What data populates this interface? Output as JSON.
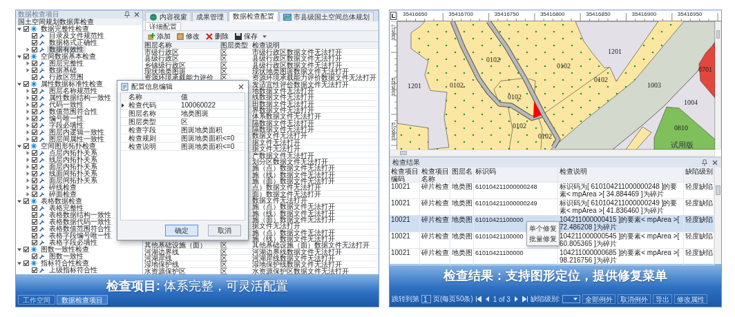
{
  "config_screen": {
    "tree": {
      "title": "数据检查项目",
      "root": "国土空间规划数据库检查",
      "groups": [
        {
          "label": "数据完整性检查",
          "checked": true,
          "expanded": true,
          "selected": false,
          "children": [
            {
              "label": "目录及文件规范性",
              "checked": true,
              "collapsed": false,
              "selected": false
            },
            {
              "label": "数据格式正确性",
              "checked": true,
              "collapsed": false,
              "selected": false
            },
            {
              "label": "数据有效性",
              "checked": true,
              "collapsed": true,
              "selected": true
            }
          ]
        },
        {
          "label": "空间数据基本检查",
          "checked": true,
          "expanded": true,
          "selected": false,
          "children": [
            {
              "label": "图层完整性",
              "checked": true,
              "collapsed": true,
              "selected": false
            },
            {
              "label": "数据基础",
              "checked": true,
              "collapsed": true,
              "selected": false
            },
            {
              "label": "行政区范围",
              "checked": true,
              "collapsed": false,
              "selected": false
            }
          ]
        },
        {
          "label": "属性数据标准性检查",
          "checked": true,
          "expanded": true,
          "selected": false,
          "children": [
            {
              "label": "图层名称规范性",
              "checked": true,
              "collapsed": true,
              "selected": false
            },
            {
              "label": "属性数据结构一致性",
              "checked": true,
              "collapsed": true,
              "selected": false
            },
            {
              "label": "代码一致性",
              "checked": true,
              "collapsed": true,
              "selected": false
            },
            {
              "label": "数值范围符合性",
              "checked": true,
              "collapsed": true,
              "selected": false
            },
            {
              "label": "编号唯一性",
              "checked": true,
              "collapsed": true,
              "selected": false
            },
            {
              "label": "字段必填性",
              "checked": true,
              "collapsed": true,
              "selected": false
            },
            {
              "label": "图层内逻辑一致性",
              "checked": true,
              "collapsed": true,
              "selected": false
            },
            {
              "label": "图层间属性一致性",
              "checked": true,
              "collapsed": true,
              "selected": false
            }
          ]
        },
        {
          "label": "空间图形拓扑检查",
          "checked": true,
          "expanded": true,
          "selected": false,
          "children": [
            {
              "label": "点层内拓扑关系",
              "checked": true,
              "collapsed": true,
              "selected": false
            },
            {
              "label": "线层内拓扑关系",
              "checked": true,
              "collapsed": true,
              "selected": false
            },
            {
              "label": "面层内拓扑关系",
              "checked": true,
              "collapsed": true,
              "selected": false
            },
            {
              "label": "线面间拓扑关系",
              "checked": true,
              "collapsed": true,
              "selected": false
            },
            {
              "label": "面层间拓扑关系",
              "checked": true,
              "collapsed": true,
              "selected": false
            },
            {
              "label": "碎线检查",
              "checked": true,
              "collapsed": true,
              "selected": false
            },
            {
              "label": "碎面检查",
              "checked": true,
              "collapsed": true,
              "selected": false
            }
          ]
        },
        {
          "label": "表格数据检查",
          "checked": true,
          "expanded": true,
          "selected": false,
          "children": [
            {
              "label": "表格完整性",
              "checked": true,
              "collapsed": false,
              "selected": false
            },
            {
              "label": "表格数据结构一致性",
              "checked": true,
              "collapsed": false,
              "selected": false
            },
            {
              "label": "表格数据代码一致性",
              "checked": true,
              "collapsed": false,
              "selected": false
            },
            {
              "label": "表格数值范围符合性",
              "checked": true,
              "collapsed": false,
              "selected": false
            },
            {
              "label": "表格字段编号唯一性",
              "checked": true,
              "collapsed": false,
              "selected": false
            },
            {
              "label": "表格字段必填性",
              "checked": true,
              "collapsed": false,
              "selected": false
            }
          ]
        },
        {
          "label": "图数一致性检查",
          "checked": true,
          "expanded": true,
          "selected": false,
          "children": [
            {
              "label": "图数一致性",
              "checked": true,
              "collapsed": false,
              "selected": false
            }
          ]
        },
        {
          "label": "指标符合性检查",
          "checked": true,
          "expanded": true,
          "selected": false,
          "children": [
            {
              "label": "上级指标符合性",
              "checked": true,
              "collapsed": false,
              "selected": false
            }
          ]
        }
      ]
    },
    "tabs": [
      {
        "label": "内容视窗",
        "kind": "icon",
        "selected": false
      },
      {
        "label": "成果管理",
        "kind": "plain",
        "selected": false
      },
      {
        "label": "数据检查配置",
        "kind": "plain",
        "selected": true
      },
      {
        "label": "市县级国土空间总体规划",
        "kind": "icon",
        "selected": false
      }
    ],
    "subtab": "详细配置",
    "toolbar": [
      "添加",
      "修改",
      "删除",
      "保存"
    ],
    "table": {
      "columns": [
        "图层名称",
        "图层类型",
        "检查说明"
      ],
      "rows": [
        {
          "name": "市级行政区",
          "type": "区",
          "note": "市级行政区数据文件无法打开"
        },
        {
          "name": "县级行政区",
          "type": "区",
          "note": "县级行政区数据文件无法打开"
        },
        {
          "name": "乡镇级行政区",
          "type": "区",
          "note": "县级行政区数据文件无法打开"
        },
        {
          "name": "现状地类图斑",
          "type": "区",
          "note": "现状地类图斑数据文件无法打开"
        },
        {
          "name": "资源环境承载能力评价",
          "type": "区",
          "note": "资源环境承载能力评价数据文件无法打开"
        },
        {
          "note": "发适宜性评价数据文件无法打开"
        },
        {
          "note": "地数据文件无法打开"
        },
        {
          "note": "线数据文件无法打开"
        },
        {
          "note": "田数据文件无法打开"
        },
        {
          "note": "界数据文件无法打开"
        },
        {
          "note": "体系数据文件无法打开"
        },
        {
          "note": "隔数据文件无法打开"
        },
        {
          "note": "隔数据文件无法打开"
        },
        {
          "note": "数据文件无法打开"
        },
        {
          "note": "据文件无法打开"
        },
        {
          "note": "据文件无法打开"
        },
        {
          "note": "产数据文件无法打开"
        },
        {
          "note": "划分区数据文件无法打开"
        },
        {
          "note": "施（点）数据文件无法打开"
        },
        {
          "note": "施（线）数据文件无法打开"
        },
        {
          "note": "施（面）数据文件无法打开"
        },
        {
          "note": "点）数据文件无法打开"
        },
        {
          "note": "面）数据文件无法打开"
        },
        {
          "note": "数据文件无法打开"
        },
        {
          "note": "施（点）数据文件无法打开"
        },
        {
          "note": "施（线）数据文件无法打开"
        },
        {
          "note": "施（面）数据文件无法打开"
        },
        {
          "note": "据文件无法打开"
        },
        {
          "note": "施（点）数据文件无法打开"
        },
        {
          "note": "施（线）数据文件无法打开"
        },
        {
          "name": "其他基础设施（面）",
          "type": "区",
          "note": "其他基础设施（面）数据文件无法打开"
        },
        {
          "name": "河湖边界线",
          "type": "区",
          "note": "河湖边界线数据文件无法打开"
        },
        {
          "name": "河湖岸线",
          "type": "区",
          "note": "河湖岸线数据文件无法打开"
        },
        {
          "name": "湿地保护线",
          "type": "区",
          "note": "湿地保护线数据文件无法打开"
        },
        {
          "name": "水资源保护区",
          "type": "区",
          "note": "水资源保护区数据文件无法打开"
        }
      ]
    },
    "dialog": {
      "title": "配置信息编辑",
      "columns": [
        "名称",
        "值"
      ],
      "rows": [
        {
          "name": "检查代码",
          "value": "100060022",
          "current": true
        },
        {
          "name": "图层名称",
          "value": "地类图斑",
          "current": false
        },
        {
          "name": "图层类型",
          "value": "区",
          "current": false
        },
        {
          "name": "检查字段",
          "value": "图斑地类面积",
          "current": false
        },
        {
          "name": "检查规则",
          "value": "图斑地类面积<=0",
          "current": false
        },
        {
          "name": "检查说明",
          "value": "图斑地类面积<=0",
          "current": false
        }
      ],
      "buttons": [
        {
          "label": "确定",
          "focused": true
        },
        {
          "label": "取消",
          "focused": false
        }
      ]
    },
    "bottom_tabs": [
      {
        "label": "工作空间",
        "selected": false
      },
      {
        "label": "数据检查项目",
        "selected": true
      }
    ],
    "caption": "**检查项目:** 体系完整，可灵活配置"
  },
  "results_screen": {
    "map": {
      "corner_label": "L",
      "x_ruler": [
        "35416650",
        "35416700",
        "35416750",
        "35416800",
        "35416850",
        "35416900",
        "35416950"
      ],
      "y_ruler": [
        "338617",
        "3386125",
        "3386075"
      ],
      "labels": [
        "1201",
        "0102",
        "0102",
        "0102",
        "0102",
        "0102",
        "0102",
        "0102",
        "1201",
        "1003",
        "1004",
        "0701",
        "0810"
      ],
      "trial_mark": "试用版"
    },
    "results": {
      "title": "检查结果",
      "columns": [
        "检查项目编码",
        "检查项目名称",
        "图层名",
        "标识码",
        "检查说明",
        "缺陷级别"
      ],
      "rows": [
        {
          "code": "10021",
          "name": "碎片检查",
          "layer": "地类图",
          "id": "610104211000000248",
          "note": "标识码为[ 610104211000000248 ]的要素< mpArea >[ 34.884469 ]为碎片",
          "level": "轻度缺陷",
          "selected": false
        },
        {
          "code": "10021",
          "name": "碎片检查",
          "layer": "地类图",
          "id": "610104211000000249",
          "note": "标识码为[ 610104211000000249 ]的要素< mpArea >[ 41.836460 ]为碎片",
          "level": "轻度缺陷",
          "selected": false
        },
        {
          "code": "10021",
          "name": "碎片检查",
          "layer": "地类图",
          "id": "61010421100000",
          "note": "104211000000415 ]的要素< mpArea >[ 72.486208 ]为碎片",
          "level": "轻度缺陷",
          "selected": true
        },
        {
          "code": "10021",
          "name": "碎片检查",
          "layer": "地类图",
          "id": "61010421100000",
          "note": "104211000000545 ]的要素< mpArea >[ 60.805365 ]为碎片",
          "level": "轻度缺陷",
          "selected": false
        },
        {
          "code": "10021",
          "name": "碎片检查",
          "layer": "地类图",
          "id": "61010421100000",
          "note": "104211000000685 ]的要素< mpArea >[ 98.216756 ]为碎片",
          "level": "轻度缺陷",
          "selected": false
        }
      ]
    },
    "context_menu": [
      "单个修复",
      "批量修复"
    ],
    "pager": {
      "jump_label": "跳转到第",
      "page": "1",
      "page_note": "页(每页50条)",
      "position": "1 of 3",
      "level_label": "缺陷级别:",
      "buttons": [
        "全部例外",
        "取消例外",
        "导出",
        "修改属性"
      ]
    },
    "caption": "检查结果：支持图形定位，提供修复菜单"
  }
}
